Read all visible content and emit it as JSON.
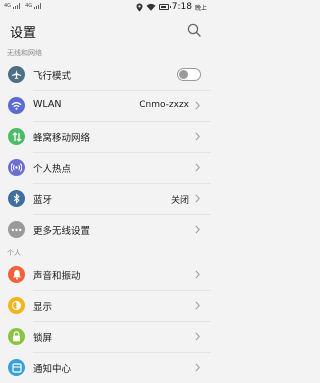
{
  "status_bar": {
    "sim1_label": "4G",
    "sim2_label": "4G",
    "time": "7:18",
    "ampm": "晚上",
    "icons": [
      "location-icon",
      "wifi-icon",
      "battery-icon"
    ]
  },
  "header": {
    "title": "设置"
  },
  "sections": {
    "wireless": "无线和网络",
    "personal": "个人"
  },
  "items": {
    "airplane": {
      "label": "飞行模式",
      "icon": "airplane-icon",
      "color": "#4f6f86",
      "toggle": "off"
    },
    "wlan": {
      "label": "WLAN",
      "value": "Cnmo-zxzx",
      "icon": "wifi-icon",
      "color": "#5b6bd2"
    },
    "mobile": {
      "label": "蜂窝移动网络",
      "icon": "mobile-data-icon",
      "color": "#4dbb6a"
    },
    "hotspot": {
      "label": "个人热点",
      "icon": "hotspot-icon",
      "color": "#6d6fd0"
    },
    "bluetooth": {
      "label": "蓝牙",
      "value": "关闭",
      "icon": "bluetooth-icon",
      "color": "#3f6fa0"
    },
    "more": {
      "label": "更多无线设置",
      "icon": "more-icon",
      "color": "#9a9a9a"
    },
    "sound": {
      "label": "声音和振动",
      "icon": "bell-icon",
      "color": "#f1623a"
    },
    "display": {
      "label": "显示",
      "icon": "display-icon",
      "color": "#f4b41a"
    },
    "lock": {
      "label": "锁屏",
      "icon": "lock-icon",
      "color": "#8ac43f"
    },
    "notification": {
      "label": "通知中心",
      "icon": "notification-icon",
      "color": "#3aa0d8"
    }
  }
}
